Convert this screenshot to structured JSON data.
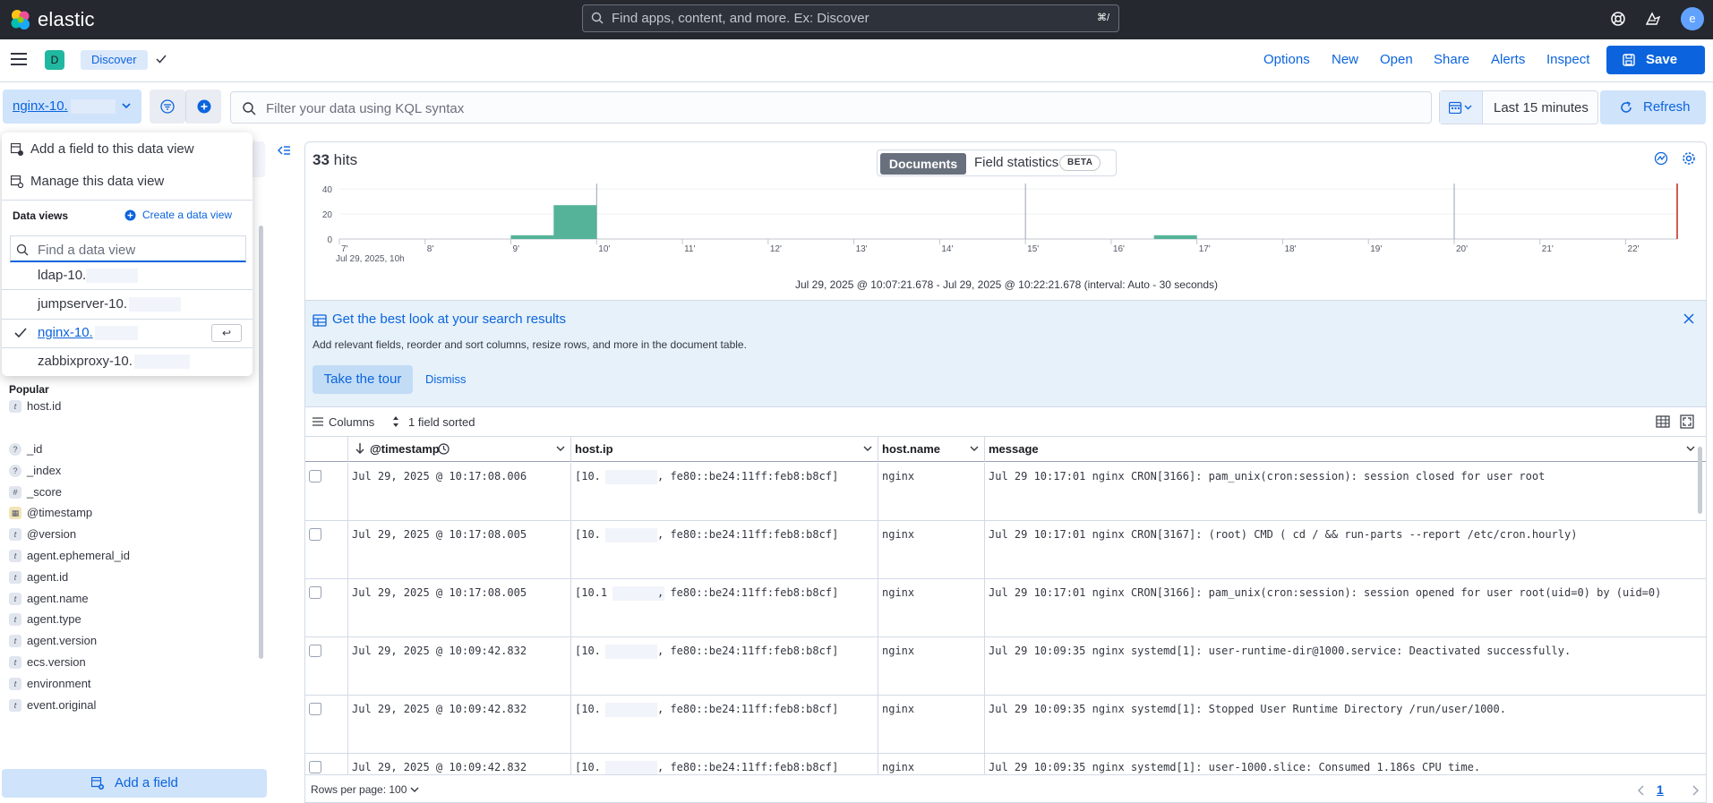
{
  "header": {
    "brand": "elastic",
    "search_placeholder": "Find apps, content, and more. Ex: Discover",
    "search_shortcut": "⌘/",
    "avatar_initial": "e"
  },
  "nav": {
    "space_initial": "D",
    "breadcrumb": "Discover",
    "links": [
      "Options",
      "New",
      "Open",
      "Share",
      "Alerts",
      "Inspect"
    ],
    "save_label": "Save"
  },
  "query": {
    "data_view": "nginx-10.",
    "kql_placeholder": "Filter your data using KQL syntax",
    "time_range": "Last 15 minutes",
    "refresh_label": "Refresh"
  },
  "popover": {
    "add_field": "Add a field to this data view",
    "manage": "Manage this data view",
    "title": "Data views",
    "create": "Create a data view",
    "search_placeholder": "Find a data view",
    "items": [
      {
        "name": "ldap-10.",
        "selected": false
      },
      {
        "name": "jumpserver-10.",
        "selected": false
      },
      {
        "name": "nginx-10.",
        "selected": true
      },
      {
        "name": "zabbixproxy-10.",
        "selected": false
      }
    ],
    "enter_key": "↩"
  },
  "sidebar": {
    "popular_title": "Popular",
    "popular": [
      {
        "name": "host.id",
        "type": "t"
      }
    ],
    "fields": [
      {
        "name": "_id",
        "type": "?"
      },
      {
        "name": "_index",
        "type": "?"
      },
      {
        "name": "_score",
        "type": "#"
      },
      {
        "name": "@timestamp",
        "type": "date"
      },
      {
        "name": "@version",
        "type": "t"
      },
      {
        "name": "agent.ephemeral_id",
        "type": "t"
      },
      {
        "name": "agent.id",
        "type": "t"
      },
      {
        "name": "agent.name",
        "type": "t"
      },
      {
        "name": "agent.type",
        "type": "t"
      },
      {
        "name": "agent.version",
        "type": "t"
      },
      {
        "name": "ecs.version",
        "type": "t"
      },
      {
        "name": "environment",
        "type": "t"
      },
      {
        "name": "event.original",
        "type": "t"
      }
    ],
    "add_field_label": "Add a field"
  },
  "main": {
    "hits_count": "33",
    "hits_label": "hits",
    "tab_documents": "Documents",
    "tab_field_stats": "Field statistics",
    "beta": "BETA",
    "chart_caption": "Jul 29, 2025 @ 10:07:21.678 - Jul 29, 2025 @ 10:22:21.678 (interval: Auto - 30 seconds)",
    "callout_title": "Get the best look at your search results",
    "callout_desc": "Add relevant fields, reorder and sort columns, resize rows, and more in the document table.",
    "tour_label": "Take the tour",
    "dismiss_label": "Dismiss",
    "columns_label": "Columns",
    "sorted_label": "1 field sorted",
    "rows_per_page": "Rows per page: 100",
    "current_page": "1"
  },
  "chart_data": {
    "type": "bar",
    "y_ticks": [
      "40",
      "20",
      "0"
    ],
    "ylim": [
      0,
      40
    ],
    "x_ticks": [
      "7'",
      "8'",
      "9'",
      "10'",
      "11'",
      "12'",
      "13'",
      "14'",
      "15'",
      "16'",
      "17'",
      "18'",
      "19'",
      "20'",
      "21'",
      "22'"
    ],
    "x_sublabel": "Jul 29, 2025, 10h",
    "bars": [
      {
        "minute": 9.5,
        "value": 3
      },
      {
        "minute": 10.0,
        "value": 27
      },
      {
        "minute": 17.0,
        "value": 3
      }
    ],
    "bar_color": "#54b399",
    "now_color": "#bd271e"
  },
  "table": {
    "columns": [
      "@timestamp",
      "host.ip",
      "host.name",
      "message"
    ],
    "rows": [
      {
        "timestamp": "Jul 29, 2025 @ 10:17:08.006",
        "ip_prefix": "[10.",
        "ip_suffix": ", fe80::be24:11ff:feb8:b8cf]",
        "host": "nginx",
        "message": "Jul 29 10:17:01 nginx CRON[3166]: pam_unix(cron:session): session closed for user root"
      },
      {
        "timestamp": "Jul 29, 2025 @ 10:17:08.005",
        "ip_prefix": "[10.",
        "ip_suffix": ", fe80::be24:11ff:feb8:b8cf]",
        "host": "nginx",
        "message": "Jul 29 10:17:01 nginx CRON[3167]: (root) CMD ( cd / && run-parts --report /etc/cron.hourly)"
      },
      {
        "timestamp": "Jul 29, 2025 @ 10:17:08.005",
        "ip_prefix": "[10.1",
        "ip_suffix": ", fe80::be24:11ff:feb8:b8cf]",
        "host": "nginx",
        "message": "Jul 29 10:17:01 nginx CRON[3166]: pam_unix(cron:session): session opened for user root(uid=0) by (uid=0)"
      },
      {
        "timestamp": "Jul 29, 2025 @ 10:09:42.832",
        "ip_prefix": "[10.",
        "ip_suffix": ", fe80::be24:11ff:feb8:b8cf]",
        "host": "nginx",
        "message": "Jul 29 10:09:35 nginx systemd[1]: user-runtime-dir@1000.service: Deactivated successfully."
      },
      {
        "timestamp": "Jul 29, 2025 @ 10:09:42.832",
        "ip_prefix": "[10.",
        "ip_suffix": ", fe80::be24:11ff:feb8:b8cf]",
        "host": "nginx",
        "message": "Jul 29 10:09:35 nginx systemd[1]: Stopped User Runtime Directory /run/user/1000."
      },
      {
        "timestamp": "Jul 29, 2025 @ 10:09:42.832",
        "ip_prefix": "[10.",
        "ip_suffix": ", fe80::be24:11ff:feb8:b8cf]",
        "host": "nginx",
        "message": "Jul 29 10:09:35 nginx systemd[1]: user-1000.slice: Consumed 1.186s CPU time."
      }
    ]
  }
}
